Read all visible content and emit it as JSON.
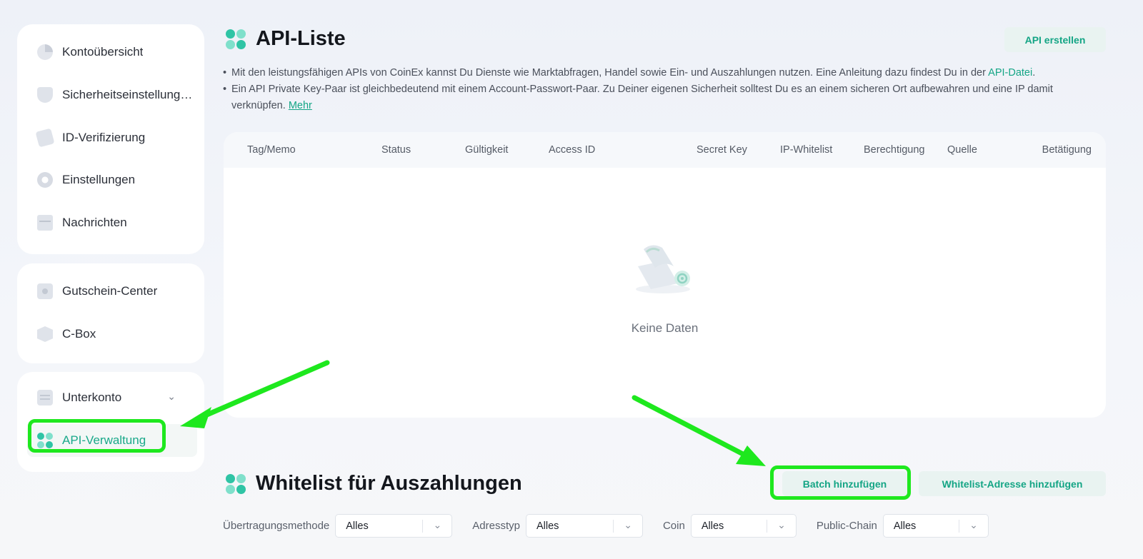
{
  "sidebar": {
    "group1": [
      {
        "label": "Kontoübersicht",
        "icon": "pie-chart-icon"
      },
      {
        "label": "Sicherheitseinstellung…",
        "icon": "shield-icon"
      },
      {
        "label": "ID-Verifizierung",
        "icon": "id-card-icon"
      },
      {
        "label": "Einstellungen",
        "icon": "gear-icon"
      },
      {
        "label": "Nachrichten",
        "icon": "message-icon"
      }
    ],
    "group2": [
      {
        "label": "Gutschein-Center",
        "icon": "coupon-icon"
      },
      {
        "label": "C-Box",
        "icon": "box-icon"
      }
    ],
    "group3": [
      {
        "label": "Unterkonto",
        "icon": "subaccount-icon"
      },
      {
        "label": "API-Verwaltung",
        "icon": "api-icon",
        "active": true
      }
    ]
  },
  "api_list": {
    "title": "API-Liste",
    "create_button": "API erstellen",
    "note1_text": "Mit den leistungsfähigen APIs von CoinEx kannst Du Dienste wie Marktabfragen, Handel sowie Ein- und Auszahlungen nutzen. Eine Anleitung dazu findest Du in der ",
    "note1_link": "API-Datei",
    "note1_end": ".",
    "note2_text": "Ein API Private Key-Paar ist gleichbedeutend mit einem Account-Passwort-Paar. Zu Deiner eigenen Sicherheit solltest Du es an einem sicheren Ort aufbewahren und eine IP damit verknüpfen. ",
    "note2_link": "Mehr",
    "columns": [
      "Tag/Memo",
      "Status",
      "Gültigkeit",
      "Access ID",
      "Secret Key",
      "IP-Whitelist",
      "Berechtigung",
      "Quelle",
      "Betätigung"
    ],
    "empty_text": "Keine Daten"
  },
  "whitelist": {
    "title": "Whitelist für Auszahlungen",
    "batch_button": "Batch hinzufügen",
    "add_button": "Whitelist-Adresse hinzufügen",
    "filters": [
      {
        "label": "Übertragungsmethode",
        "value": "Alles"
      },
      {
        "label": "Adresstyp",
        "value": "Alles"
      },
      {
        "label": "Coin",
        "value": "Alles"
      },
      {
        "label": "Public-Chain",
        "value": "Alles"
      }
    ]
  },
  "colors": {
    "accent": "#14a585",
    "highlight": "#1ee81e"
  }
}
